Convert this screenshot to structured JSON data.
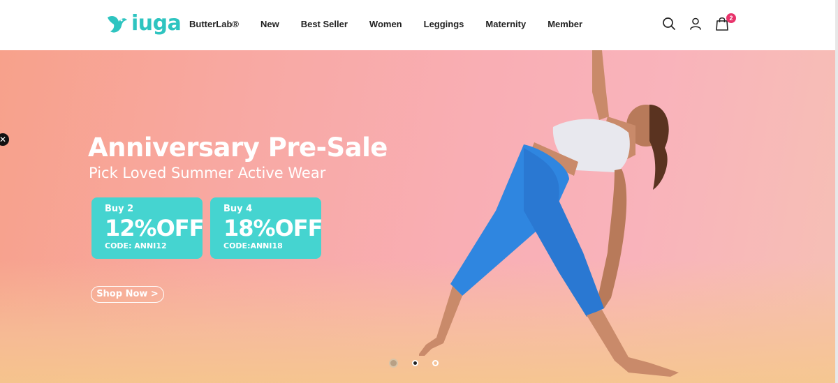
{
  "brand": {
    "logo_text": "iuga"
  },
  "nav": {
    "items": [
      {
        "label": "ButterLab®"
      },
      {
        "label": "New"
      },
      {
        "label": "Best Seller"
      },
      {
        "label": "Women"
      },
      {
        "label": "Leggings"
      },
      {
        "label": "Maternity"
      },
      {
        "label": "Member"
      }
    ]
  },
  "header_icons": {
    "search": "search-icon",
    "account": "user-icon",
    "cart": "shopping-bag-icon",
    "cart_count": "2"
  },
  "hero": {
    "close_label": "✕",
    "headline": "Anniversary Pre-Sale",
    "subline": "Pick Loved Summer Active Wear",
    "coupons": [
      {
        "buy": "Buy 2",
        "discount": "12%",
        "off": "OFF",
        "code": "CODE: ANNI12"
      },
      {
        "buy": "Buy 4",
        "discount": "18%",
        "off": "OFF",
        "code": "CODE:ANNI18"
      }
    ],
    "cta_label": "Shop Now >",
    "slides": {
      "total": 3,
      "active": 2
    }
  },
  "colors": {
    "accent": "#45d4d0",
    "logo": "#2ec4c0",
    "badge": "#e8336b",
    "hero_bg": "#f9aeb4"
  }
}
